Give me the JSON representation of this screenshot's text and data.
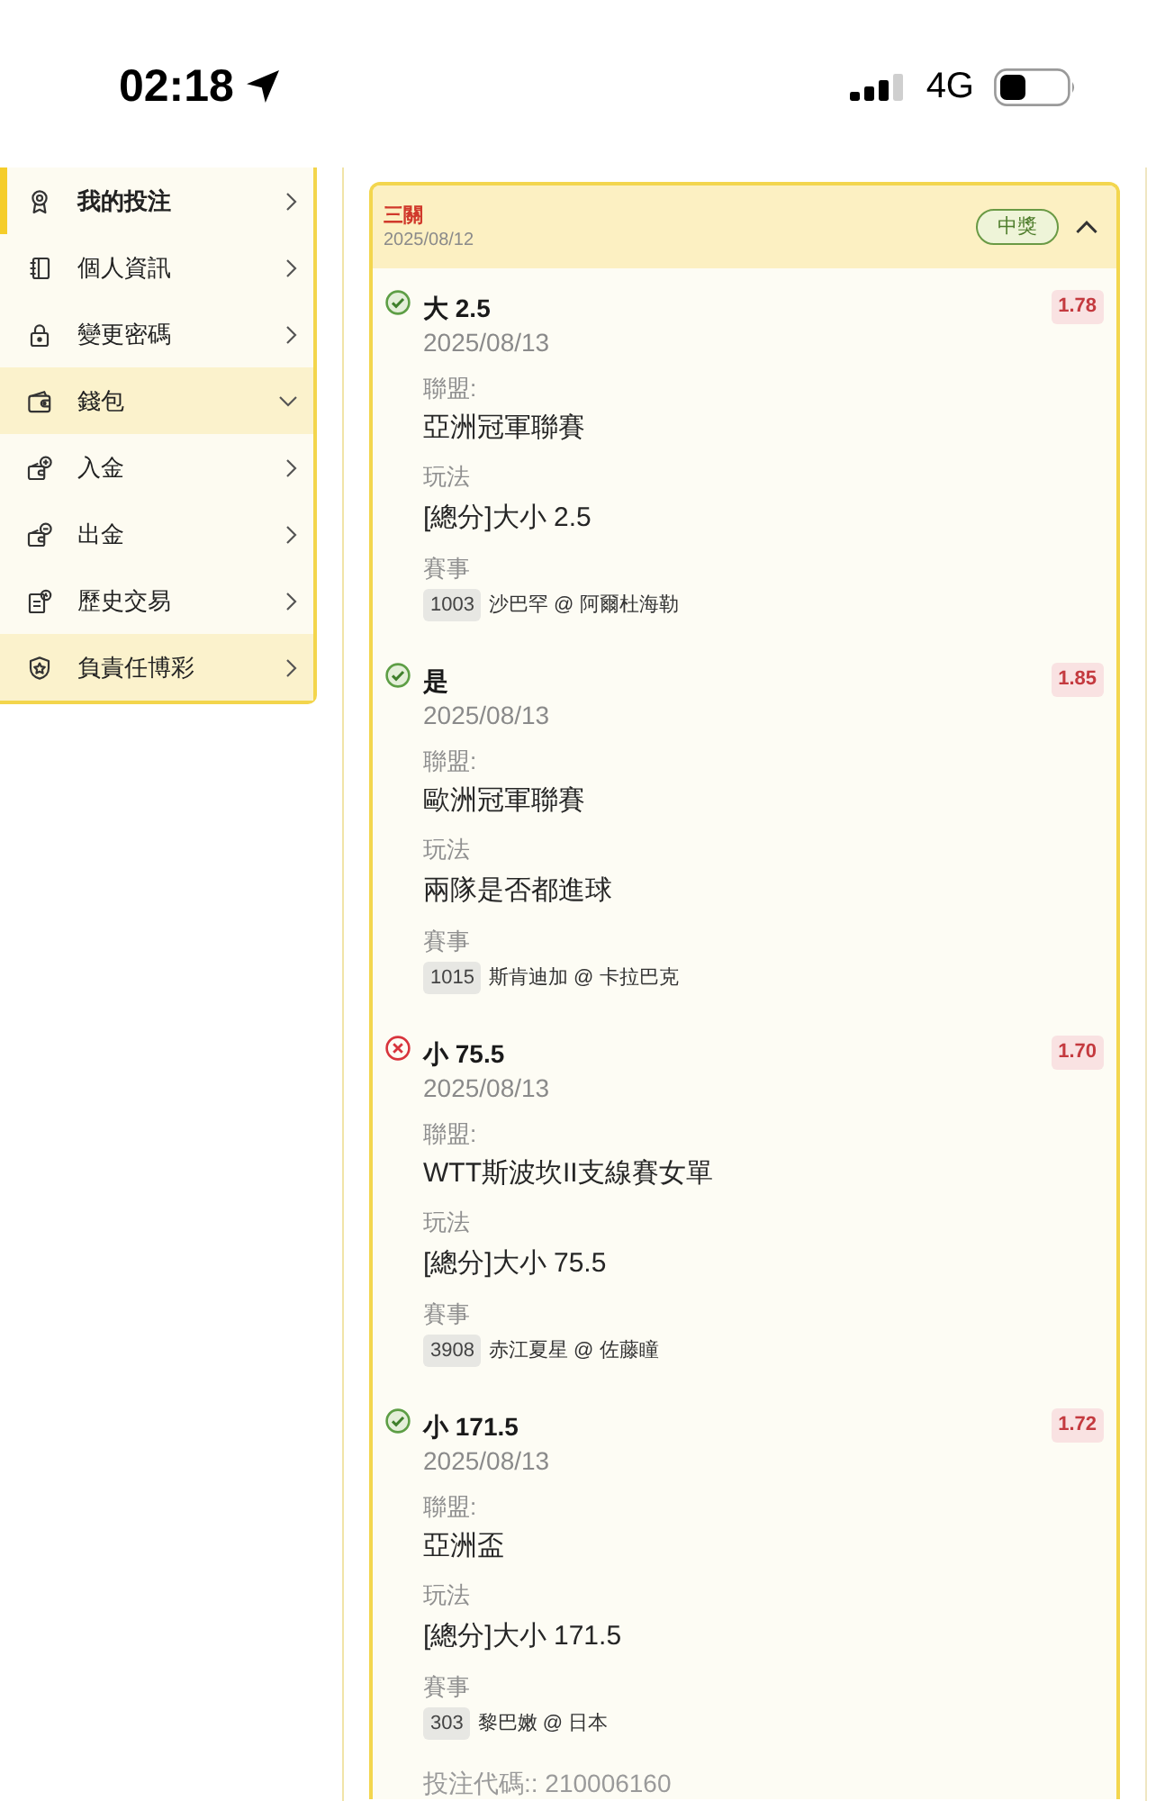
{
  "status_bar": {
    "time": "02:18",
    "network": "4G"
  },
  "sidebar": {
    "items": [
      {
        "label": "我的投注",
        "selected": true,
        "highlighted": false,
        "expanded": false
      },
      {
        "label": "個人資訊",
        "selected": false,
        "highlighted": false,
        "expanded": false
      },
      {
        "label": "變更密碼",
        "selected": false,
        "highlighted": false,
        "expanded": false
      },
      {
        "label": "錢包",
        "selected": false,
        "highlighted": true,
        "expanded": true,
        "children": [
          {
            "label": "入金",
            "selected": false,
            "highlighted": false,
            "expanded": false
          },
          {
            "label": "出金",
            "selected": false,
            "highlighted": false,
            "expanded": false
          }
        ]
      },
      {
        "label": "歷史交易",
        "selected": false,
        "highlighted": false,
        "expanded": false
      },
      {
        "label": "負責任博彩",
        "selected": false,
        "highlighted": true,
        "expanded": false
      }
    ]
  },
  "bet_card": {
    "type": "三關",
    "date": "2025/08/12",
    "status": "中獎",
    "expanded": true,
    "legs": [
      {
        "won": true,
        "selection": "大 2.5",
        "odds": "1.78",
        "date": "2025/08/13",
        "league_label": "聯盟:",
        "league": "亞洲冠軍聯賽",
        "market_label": "玩法",
        "market": "[總分]大小 2.5",
        "event_label": "賽事",
        "event_code": "1003",
        "event": "沙巴罕 @ 阿爾杜海勒"
      },
      {
        "won": true,
        "selection": "是",
        "odds": "1.85",
        "date": "2025/08/13",
        "league_label": "聯盟:",
        "league": "歐洲冠軍聯賽",
        "market_label": "玩法",
        "market": "兩隊是否都進球",
        "event_label": "賽事",
        "event_code": "1015",
        "event": "斯肯迪加 @ 卡拉巴克"
      },
      {
        "won": false,
        "selection": "小 75.5",
        "odds": "1.70",
        "date": "2025/08/13",
        "league_label": "聯盟:",
        "league": "WTT斯波坎II支線賽女單",
        "market_label": "玩法",
        "market": "[總分]大小 75.5",
        "event_label": "賽事",
        "event_code": "3908",
        "event": "赤江夏星 @ 佐藤瞳"
      },
      {
        "won": true,
        "selection": "小 171.5",
        "odds": "1.72",
        "date": "2025/08/13",
        "league_label": "聯盟:",
        "league": "亞洲盃",
        "market_label": "玩法",
        "market": "[總分]大小 171.5",
        "event_label": "賽事",
        "event_code": "303",
        "event": "黎巴嫩 @ 日本"
      }
    ],
    "bet_code": "投注代碼:: 210006160"
  }
}
